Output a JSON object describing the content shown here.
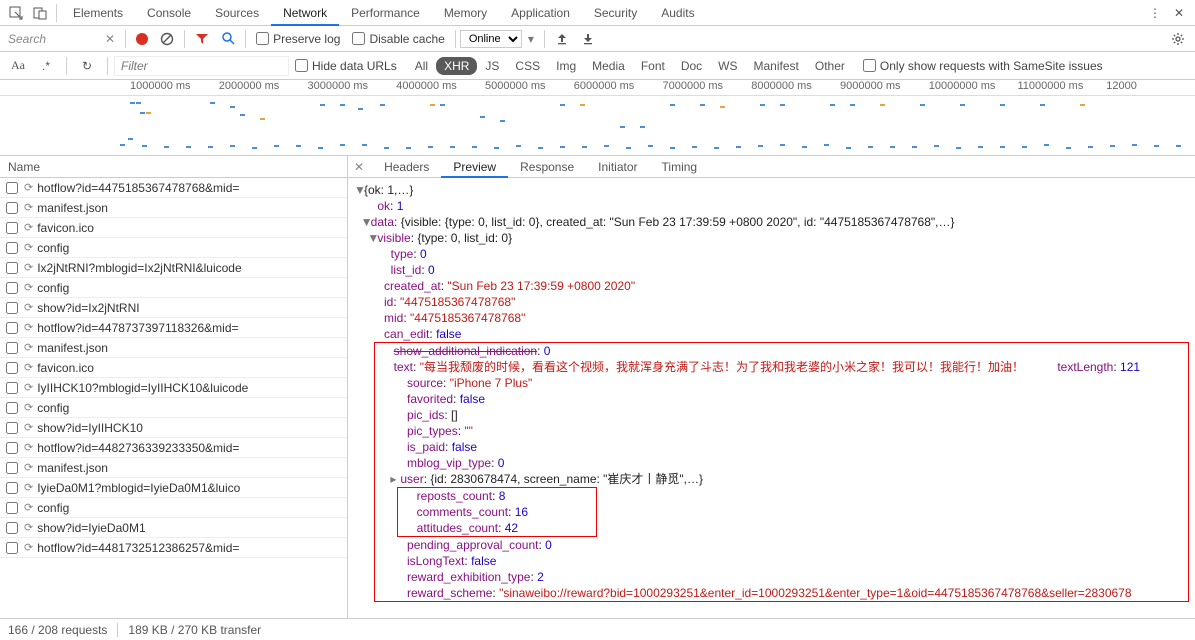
{
  "main_tabs": [
    "Elements",
    "Console",
    "Sources",
    "Network",
    "Performance",
    "Memory",
    "Application",
    "Security",
    "Audits"
  ],
  "main_tabs_active": "Network",
  "search_label": "Search",
  "toolbar": {
    "preserve_log": "Preserve log",
    "disable_cache": "Disable cache",
    "throttle": "Online"
  },
  "filter_bar": {
    "filter_placeholder": "Filter",
    "hide_data_urls": "Hide data URLs",
    "pills": [
      "All",
      "XHR",
      "JS",
      "CSS",
      "Img",
      "Media",
      "Font",
      "Doc",
      "WS",
      "Manifest",
      "Other"
    ],
    "pill_active": "XHR",
    "samesite": "Only show requests with SameSite issues"
  },
  "timeline_ticks": [
    "1000000 ms",
    "2000000 ms",
    "3000000 ms",
    "4000000 ms",
    "5000000 ms",
    "6000000 ms",
    "7000000 ms",
    "8000000 ms",
    "9000000 ms",
    "10000000 ms",
    "11000000 ms",
    "12000"
  ],
  "name_header": "Name",
  "requests": [
    {
      "icon": "⟳",
      "n": "hotflow?id=4475185367478768&mid="
    },
    {
      "icon": "⟳",
      "n": "manifest.json"
    },
    {
      "icon": "⟳",
      "n": "favicon.ico"
    },
    {
      "icon": "⟳",
      "n": "config"
    },
    {
      "icon": "⟳",
      "n": "Ix2jNtRNI?mblogid=Ix2jNtRNI&luicode"
    },
    {
      "icon": "⟳",
      "n": "config"
    },
    {
      "icon": "⟳",
      "n": "show?id=Ix2jNtRNI"
    },
    {
      "icon": "⟳",
      "n": "hotflow?id=4478737397118326&mid="
    },
    {
      "icon": "⟳",
      "n": "manifest.json"
    },
    {
      "icon": "⟳",
      "n": "favicon.ico"
    },
    {
      "icon": "⟳",
      "n": "IyIIHCK10?mblogid=IyIIHCK10&luicode"
    },
    {
      "icon": "⟳",
      "n": "config"
    },
    {
      "icon": "⟳",
      "n": "show?id=IyIIHCK10"
    },
    {
      "icon": "⟳",
      "n": "hotflow?id=4482736339233350&mid="
    },
    {
      "icon": "⟳",
      "n": "manifest.json"
    },
    {
      "icon": "⟳",
      "n": "IyieDa0M1?mblogid=IyieDa0M1&luico"
    },
    {
      "icon": "⟳",
      "n": "config"
    },
    {
      "icon": "⟳",
      "n": "show?id=IyieDa0M1"
    },
    {
      "icon": "⟳",
      "n": "hotflow?id=4481732512386257&mid="
    }
  ],
  "resp_tabs": [
    "Headers",
    "Preview",
    "Response",
    "Initiator",
    "Timing"
  ],
  "resp_tab_active": "Preview",
  "json": {
    "root": "{ok: 1,…}",
    "ok": "1",
    "data_summary": "{visible: {type: 0, list_id: 0}, created_at: \"Sun Feb 23 17:39:59 +0800 2020\", id: \"4475185367478768\",…}",
    "visible_summary": "{type: 0, list_id: 0}",
    "type": "0",
    "list_id": "0",
    "created_at": "\"Sun Feb 23 17:39:59 +0800 2020\"",
    "id": "\"4475185367478768\"",
    "mid": "\"4475185367478768\"",
    "can_edit": "false",
    "show_additional_indication": "0",
    "text": "\"每当我颓废的时候，看看这个视频，我就浑身充满了斗志！为了我和我老婆的小米之家！我可以！我能行！加油！ <a data-url=\"http:",
    "textLength": "121",
    "source": "\"iPhone 7 Plus\"",
    "favorited": "false",
    "pic_ids": "[]",
    "pic_types": "\"\"",
    "is_paid": "false",
    "mblog_vip_type": "0",
    "user_summary": "{id: 2830678474, screen_name: \"崔庆才丨静觅\",…}",
    "reposts_count": "8",
    "comments_count": "16",
    "attitudes_count": "42",
    "pending_approval_count": "0",
    "isLongText": "false",
    "reward_exhibition_type": "2",
    "reward_scheme": "\"sinaweibo://reward?bid=1000293251&enter_id=1000293251&enter_type=1&oid=4475185367478768&seller=2830678"
  },
  "status": {
    "requests": "166 / 208 requests",
    "transfer": "189 KB / 270 KB transfer"
  }
}
